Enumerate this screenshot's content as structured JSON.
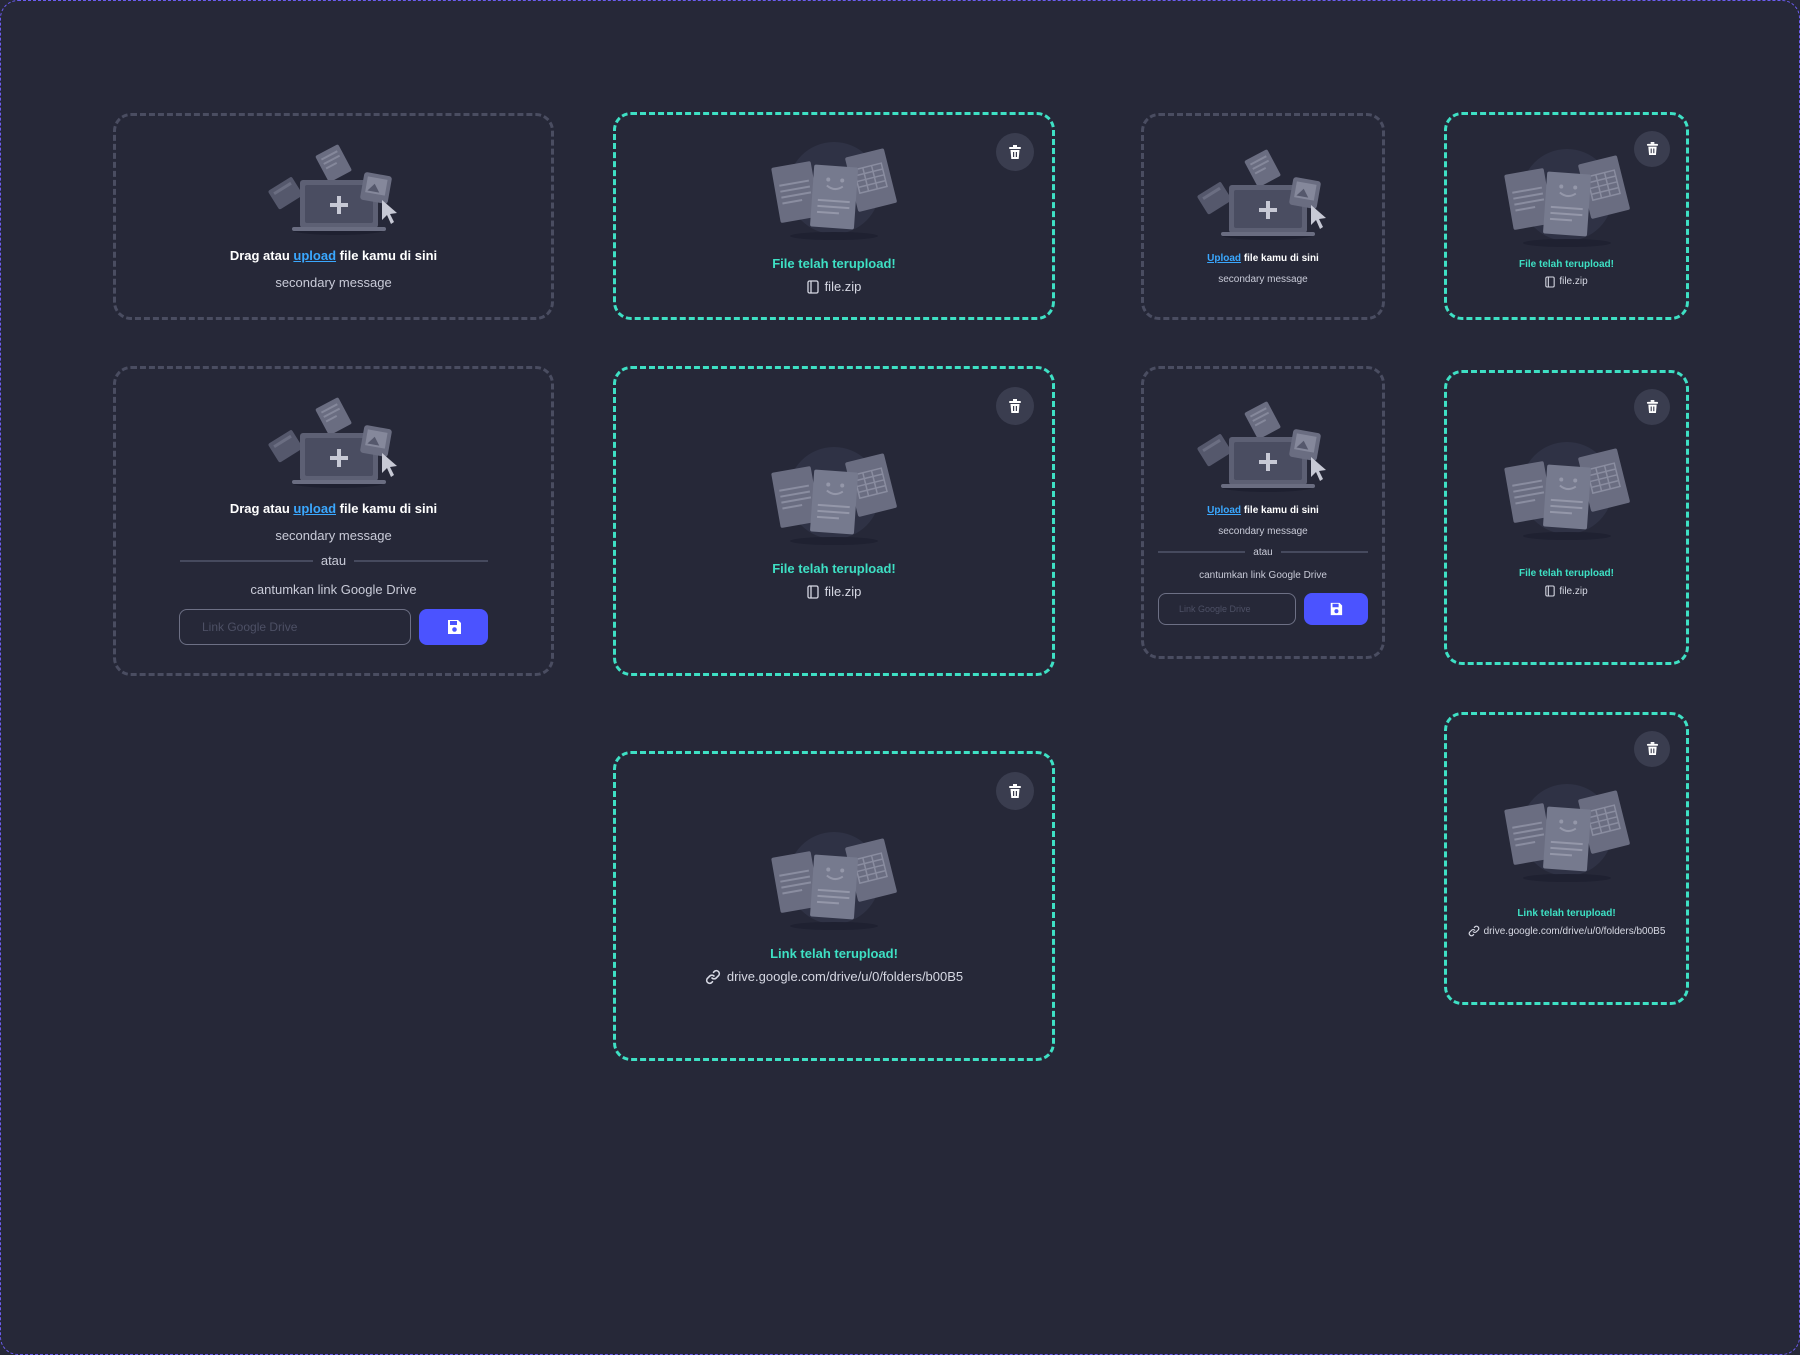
{
  "colors": {
    "background": "#262838",
    "idle_border": "#4a4d61",
    "success_border": "#3ee0c4",
    "link": "#3aa8ff",
    "save_button": "#4b53ff"
  },
  "upload": {
    "drag_prefix": "Drag atau",
    "upload_link": "upload",
    "upload_link_cap": "Upload",
    "suffix": "file kamu di sini",
    "secondary": "secondary message",
    "or": "atau",
    "gdrive_label": "cantumkan link Google Drive",
    "gdrive_placeholder": "Link Google Drive",
    "save_icon": "save-icon"
  },
  "uploaded": {
    "file_title": "File telah terupload!",
    "file_name": "file.zip",
    "link_title": "Link telah terupload!",
    "link_url": "drive.google.com/drive/u/0/folders/b00B5",
    "delete_icon": "trash-icon",
    "file_icon": "file-icon",
    "link_icon": "link-icon"
  }
}
